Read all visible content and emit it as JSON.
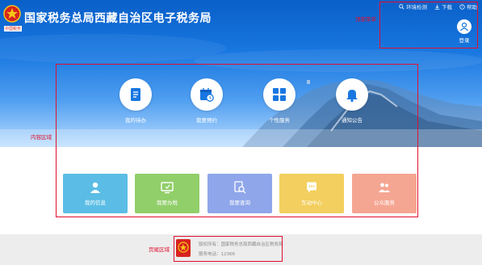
{
  "header": {
    "site_title": "国家税务总局西藏自治区电子税务局",
    "emblem_caption": "中国税务"
  },
  "topbar": {
    "env_check": "环境检测",
    "download": "下载",
    "help": "帮助"
  },
  "login": {
    "label": "登录"
  },
  "annotations": {
    "top_menu": "顶部菜单",
    "content_area": "内容区域",
    "footer_area": "页尾区域"
  },
  "services": [
    {
      "label": "我的待办",
      "icon": "clipboard-icon"
    },
    {
      "label": "我要预约",
      "icon": "calendar-clock-icon"
    },
    {
      "label": "个性服务",
      "icon": "grid-icon"
    },
    {
      "label": "通知公告",
      "icon": "bell-icon"
    }
  ],
  "cards": [
    {
      "label": "我的信息",
      "icon": "user-icon",
      "color": "#5bbde5"
    },
    {
      "label": "我要办税",
      "icon": "monitor-icon",
      "color": "#91cf6a"
    },
    {
      "label": "我要查询",
      "icon": "search-doc-icon",
      "color": "#8fa6ea"
    },
    {
      "label": "互动中心",
      "icon": "chat-icon",
      "color": "#f2cf5e"
    },
    {
      "label": "公众服务",
      "icon": "people-icon",
      "color": "#f5a692"
    }
  ],
  "footer": {
    "owner": "版权所有：国家税务总局西藏自治区税务局",
    "phone": "服务电话：12366"
  },
  "colors": {
    "brand_blue": "#1877e0",
    "annotation_red": "#e0102f"
  }
}
